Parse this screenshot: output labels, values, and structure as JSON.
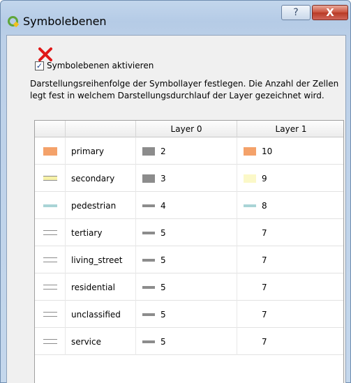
{
  "window": {
    "title": "Symbolebenen",
    "help_glyph": "?",
    "close_glyph": "X"
  },
  "enable": {
    "checked": true,
    "label": "Symbolebenen aktivieren"
  },
  "description": "Darstellungsreihenfolge der Symbollayer festlegen. Die Anzahl der Zellen legt fest in welchem Darstellungsdurchlauf der Layer gezeichnet wird.",
  "table": {
    "columns": [
      "",
      "",
      "Layer 0",
      "Layer 1"
    ],
    "rows": [
      {
        "name": "primary",
        "icon": "box",
        "color": "#f4a26a",
        "layer0": "2",
        "layer0_color": "#8c8c8c",
        "layer0_icon": "box",
        "layer1": "10",
        "layer1_color": "#f4a26a",
        "layer1_icon": "box"
      },
      {
        "name": "secondary",
        "icon": "dual-line",
        "color": "#f7f2a8",
        "layer0": "3",
        "layer0_color": "#8c8c8c",
        "layer0_icon": "box",
        "layer1": "9",
        "layer1_color": "#fbf8c8",
        "layer1_icon": "box"
      },
      {
        "name": "pedestrian",
        "icon": "line",
        "color": "#a9d4d6",
        "layer0": "4",
        "layer0_color": "#8c8c8c",
        "layer0_icon": "line",
        "layer1": "8",
        "layer1_color": "#a9d4d6",
        "layer1_icon": "line"
      },
      {
        "name": "tertiary",
        "icon": "dual-line",
        "color": "#ffffff",
        "layer0": "5",
        "layer0_color": "#8c8c8c",
        "layer0_icon": "line",
        "layer1": "7",
        "layer1_color": "#ffffff",
        "layer1_icon": "none"
      },
      {
        "name": "living_street",
        "icon": "dual-line",
        "color": "#ffffff",
        "layer0": "5",
        "layer0_color": "#8c8c8c",
        "layer0_icon": "line",
        "layer1": "7",
        "layer1_color": "#ffffff",
        "layer1_icon": "none"
      },
      {
        "name": "residential",
        "icon": "dual-line",
        "color": "#ffffff",
        "layer0": "5",
        "layer0_color": "#8c8c8c",
        "layer0_icon": "line",
        "layer1": "7",
        "layer1_color": "#ffffff",
        "layer1_icon": "none"
      },
      {
        "name": "unclassified",
        "icon": "dual-line",
        "color": "#ffffff",
        "layer0": "5",
        "layer0_color": "#8c8c8c",
        "layer0_icon": "line",
        "layer1": "7",
        "layer1_color": "#ffffff",
        "layer1_icon": "none"
      },
      {
        "name": "service",
        "icon": "dual-line",
        "color": "#ffffff",
        "layer0": "5",
        "layer0_color": "#8c8c8c",
        "layer0_icon": "line",
        "layer1": "7",
        "layer1_color": "#ffffff",
        "layer1_icon": "none"
      }
    ]
  },
  "icons": {
    "app": "qgis-logo-icon",
    "help": "help-icon",
    "close": "close-icon",
    "annotation": "red-x-icon"
  }
}
